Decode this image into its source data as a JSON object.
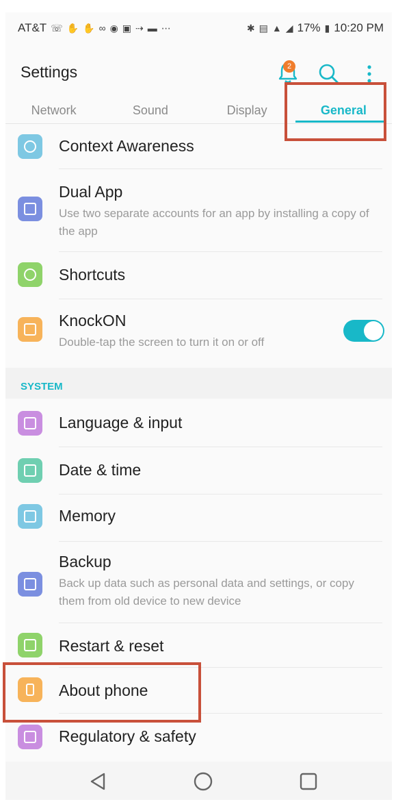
{
  "status_bar": {
    "carrier": "AT&T",
    "left_icons": [
      "whatsapp-icon",
      "hand-icon",
      "hand-icon",
      "voicemail-icon",
      "chrome-icon",
      "gallery-icon",
      "cast-icon",
      "m-icon",
      "more-dots-icon"
    ],
    "right_icons": [
      "bluetooth-icon",
      "nfc-icon",
      "wifi-icon",
      "signal-icon"
    ],
    "battery": "17%",
    "time": "10:20 PM"
  },
  "app_bar": {
    "title": "Settings",
    "notification_count": "2"
  },
  "tabs": [
    {
      "label": "Network"
    },
    {
      "label": "Sound"
    },
    {
      "label": "Display"
    },
    {
      "label": "General"
    }
  ],
  "active_tab": "General",
  "items": [
    {
      "title": "Context Awareness",
      "icon": "context-awareness-icon",
      "color": "#7ec8e3"
    },
    {
      "title": "Dual App",
      "description": "Use two separate accounts for an app by installing a copy of the app",
      "icon": "dual-app-icon",
      "color": "#7b8fe0"
    },
    {
      "title": "Shortcuts",
      "icon": "shortcuts-icon",
      "color": "#8fd36a"
    },
    {
      "title": "KnockON",
      "description": "Double-tap the screen to turn it on or off",
      "icon": "knockon-icon",
      "color": "#f7b35a",
      "toggle": true
    }
  ],
  "system_section": {
    "label": "SYSTEM",
    "items": [
      {
        "title": "Language & input",
        "icon": "language-icon",
        "color": "#c98ee0"
      },
      {
        "title": "Date & time",
        "icon": "date-time-icon",
        "color": "#6fcfb1"
      },
      {
        "title": "Memory",
        "icon": "memory-icon",
        "color": "#7ec8e3"
      },
      {
        "title": "Backup",
        "description": "Back up data such as personal data and settings, or copy them from old device to new device",
        "icon": "backup-icon",
        "color": "#7b8fe0"
      },
      {
        "title": "Restart & reset",
        "icon": "restart-reset-icon",
        "color": "#8fd36a"
      },
      {
        "title": "About phone",
        "icon": "about-phone-icon",
        "color": "#f7b35a"
      },
      {
        "title": "Regulatory & safety",
        "icon": "regulatory-icon",
        "color": "#c98ee0"
      }
    ]
  },
  "colors": {
    "accent": "#18b8c8",
    "highlight_box": "#c8503a",
    "badge": "#f07d2c"
  }
}
